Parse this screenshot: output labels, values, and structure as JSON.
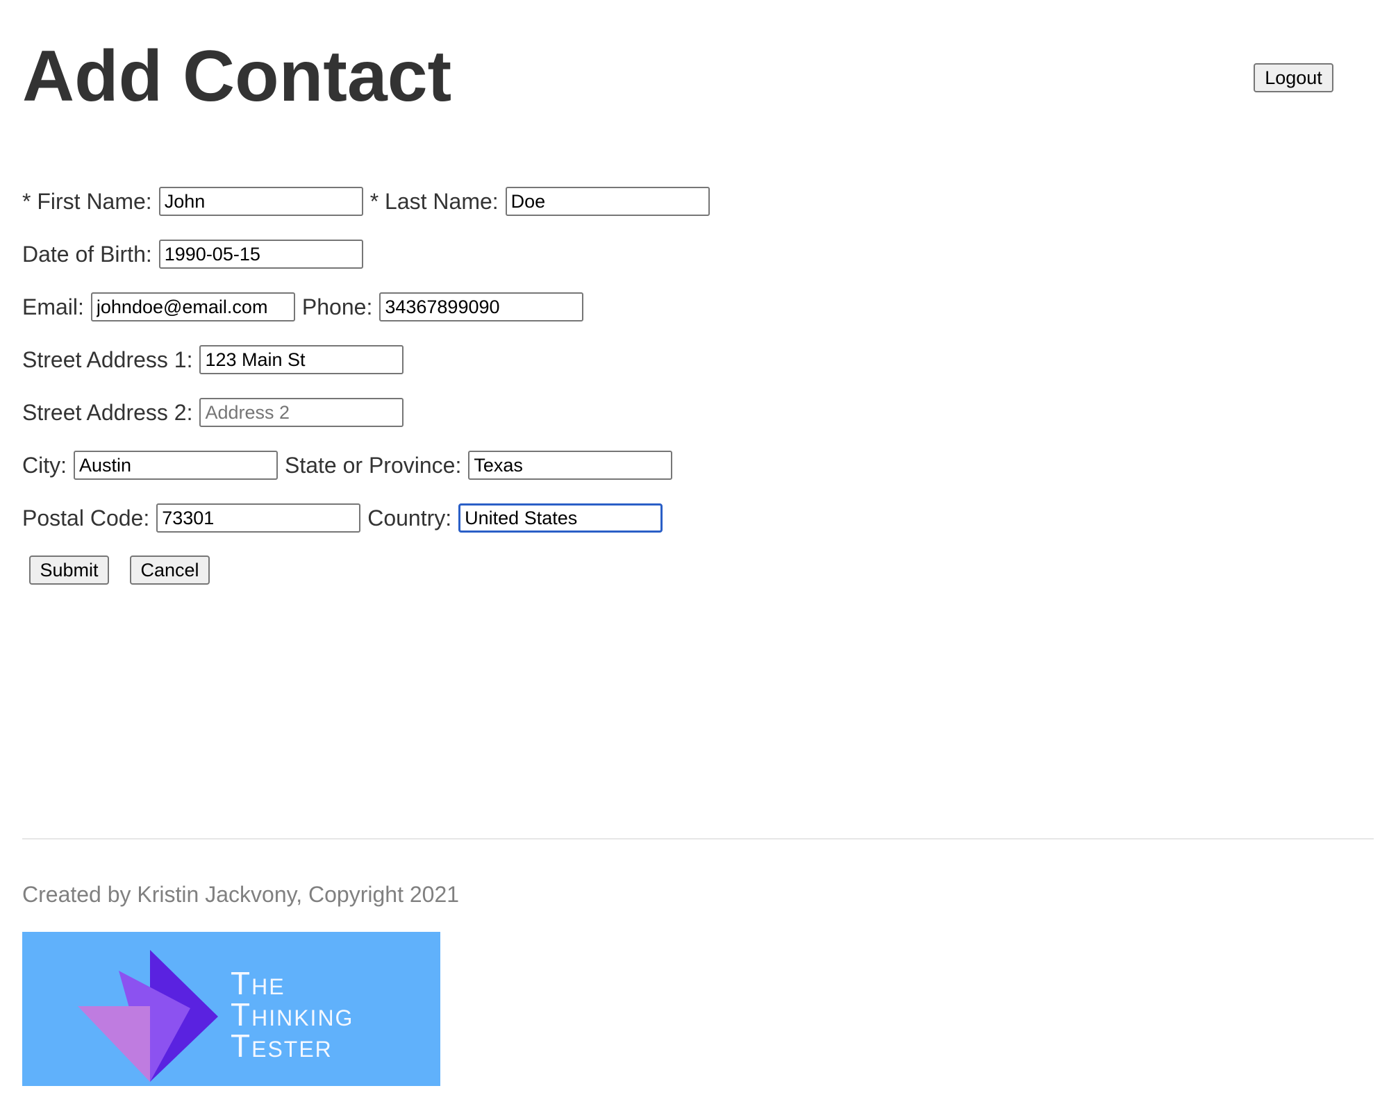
{
  "header": {
    "title": "Add Contact",
    "logout_label": "Logout"
  },
  "form": {
    "first_name": {
      "label": "* First Name:",
      "value": "John"
    },
    "last_name": {
      "label": "* Last Name:",
      "value": "Doe"
    },
    "birthdate": {
      "label": "Date of Birth:",
      "value": "1990-05-15"
    },
    "email": {
      "label": "Email:",
      "value": "johndoe@email.com"
    },
    "phone": {
      "label": "Phone:",
      "value": "34367899090"
    },
    "street1": {
      "label": "Street Address 1:",
      "value": "123 Main St"
    },
    "street2": {
      "label": "Street Address 2:",
      "value": "",
      "placeholder": "Address 2"
    },
    "city": {
      "label": "City:",
      "value": "Austin"
    },
    "state": {
      "label": "State or Province:",
      "value": "Texas"
    },
    "postal": {
      "label": "Postal Code:",
      "value": "73301"
    },
    "country": {
      "label": "Country:",
      "value": "United States"
    },
    "submit_label": "Submit",
    "cancel_label": "Cancel"
  },
  "footer": {
    "credit": "Created by Kristin Jackvony, Copyright 2021",
    "logo_lines": [
      "The",
      "Thinking",
      "Tester"
    ]
  },
  "colors": {
    "focus_border": "#2a5fc7",
    "logo_background": "#60b1fb",
    "logo_purple_dark": "#5a22e0",
    "logo_purple_mid": "#8c52f0",
    "logo_lavender": "#bf7ce0"
  }
}
